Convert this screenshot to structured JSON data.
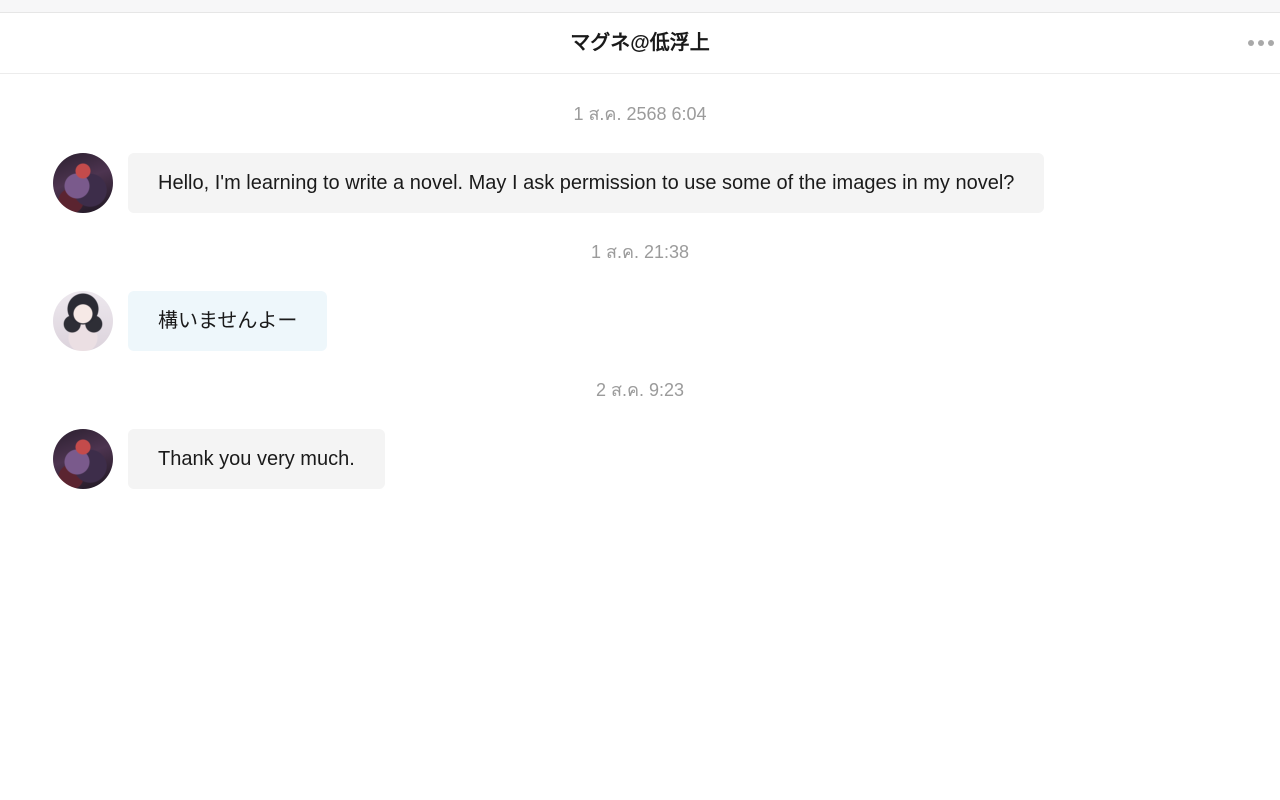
{
  "header": {
    "title": "マグネ@低浮上",
    "more_icon": "more-horizontal-icon"
  },
  "messages": [
    {
      "timestamp": "1 ส.ค. 2568 6:04",
      "sender": "self",
      "text": "Hello, I'm learning to write a novel. May I ask permission to use some of the images in my novel?"
    },
    {
      "timestamp": "1 ส.ค. 21:38",
      "sender": "other",
      "text": "構いませんよー"
    },
    {
      "timestamp": "2 ส.ค. 9:23",
      "sender": "self",
      "text": "Thank you very much."
    }
  ],
  "colors": {
    "bubble_self": "#f4f4f4",
    "bubble_other": "#eef7fb",
    "timestamp": "#9b9b9b"
  }
}
